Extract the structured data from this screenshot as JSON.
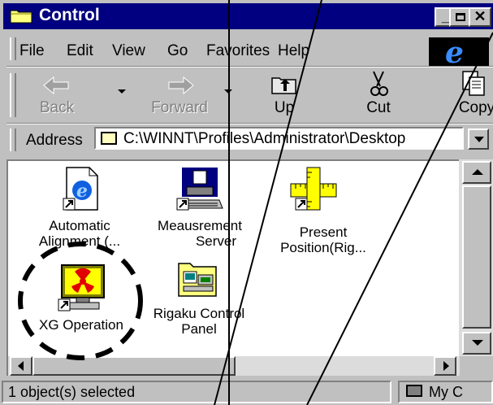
{
  "window": {
    "title": "Control"
  },
  "menu": {
    "items": [
      "File",
      "Edit",
      "View",
      "Go",
      "Favorites",
      "Help"
    ]
  },
  "toolbar": {
    "buttons": [
      {
        "label": "Back",
        "icon": "back-arrow-icon",
        "enabled": false
      },
      {
        "label": "Forward",
        "icon": "forward-arrow-icon",
        "enabled": false
      },
      {
        "label": "Up",
        "icon": "up-folder-icon",
        "enabled": true
      },
      {
        "label": "Cut",
        "icon": "scissors-icon",
        "enabled": true
      },
      {
        "label": "Copy",
        "icon": "copy-icon",
        "enabled": true
      }
    ]
  },
  "address": {
    "label": "Address",
    "value": "C:\\WINNT\\Profiles\\Administrator\\Desktop"
  },
  "items": [
    {
      "line1": "Automatic",
      "line2": "Alignment (...",
      "icon": "ie-shortcut-icon"
    },
    {
      "line1": "Meausrement",
      "line2": "Server",
      "icon": "computer-shortcut-icon"
    },
    {
      "line1": "Present",
      "line2": "Position(Rig...",
      "icon": "ruler-shortcut-icon"
    },
    {
      "line1": "XG Operation",
      "line2": "",
      "icon": "radiation-monitor-icon"
    },
    {
      "line1": "Rigaku Control",
      "line2": "Panel",
      "icon": "control-panel-folder-icon"
    }
  ],
  "status": {
    "selection": "1 object(s) selected",
    "zone": "My C"
  },
  "colors": {
    "titlebar": "#000080",
    "face": "#c0c0c0",
    "window": "#ffffff"
  }
}
